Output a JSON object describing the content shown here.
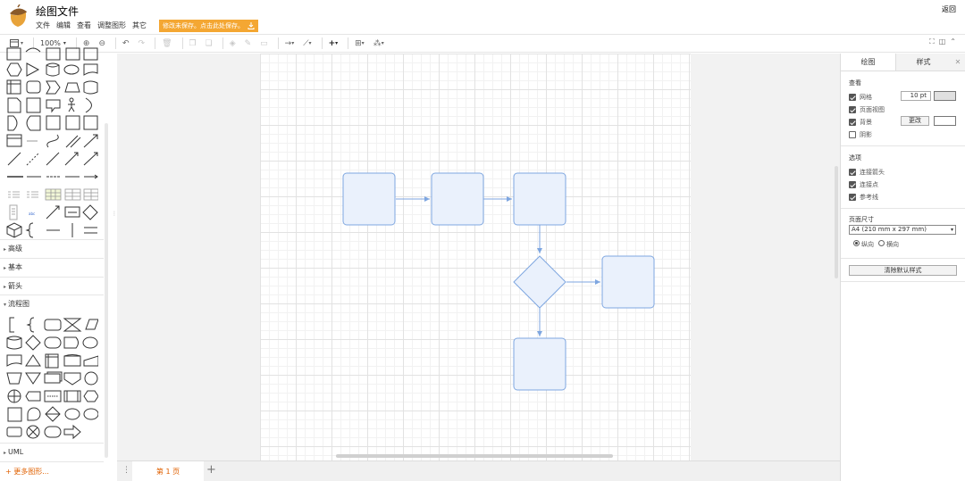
{
  "header": {
    "title": "绘图文件",
    "menu": [
      "文件",
      "编辑",
      "查看",
      "调整图形",
      "其它"
    ],
    "unsaved_notice": "修改未保存。点击此处保存。",
    "back_label": "返回"
  },
  "toolbar": {
    "zoom": "100%"
  },
  "shapes_panel": {
    "sections": [
      {
        "label": "高级",
        "expanded": false
      },
      {
        "label": "基本",
        "expanded": false
      },
      {
        "label": "箭头",
        "expanded": false
      },
      {
        "label": "流程图",
        "expanded": true
      },
      {
        "label": "UML",
        "expanded": false
      }
    ],
    "more_shapes": "+ 更多图形..."
  },
  "format_panel": {
    "tabs": [
      "绘图",
      "样式"
    ],
    "view_title": "查看",
    "view_options": [
      {
        "label": "网格",
        "checked": true
      },
      {
        "label": "页面视图",
        "checked": true
      },
      {
        "label": "背景",
        "checked": true
      },
      {
        "label": "阴影",
        "checked": false
      }
    ],
    "grid_size": "10 pt",
    "change_button": "更改",
    "options_title": "选项",
    "options": [
      {
        "label": "连接箭头",
        "checked": true
      },
      {
        "label": "连接点",
        "checked": true
      },
      {
        "label": "参考线",
        "checked": true
      }
    ],
    "paper_title": "页面尺寸",
    "paper_size": "A4 (210 mm x 297 mm)",
    "orientation": [
      {
        "label": "纵向",
        "selected": true
      },
      {
        "label": "横向",
        "selected": false
      }
    ],
    "clear_style_button": "清除默认样式"
  },
  "footer": {
    "page_tab": "第 1 页"
  },
  "colors": {
    "accent": "#e06000",
    "unsaved_bg": "#f4a733",
    "shape_fill": "#dae8fc",
    "shape_stroke": "#6c8ebf"
  }
}
